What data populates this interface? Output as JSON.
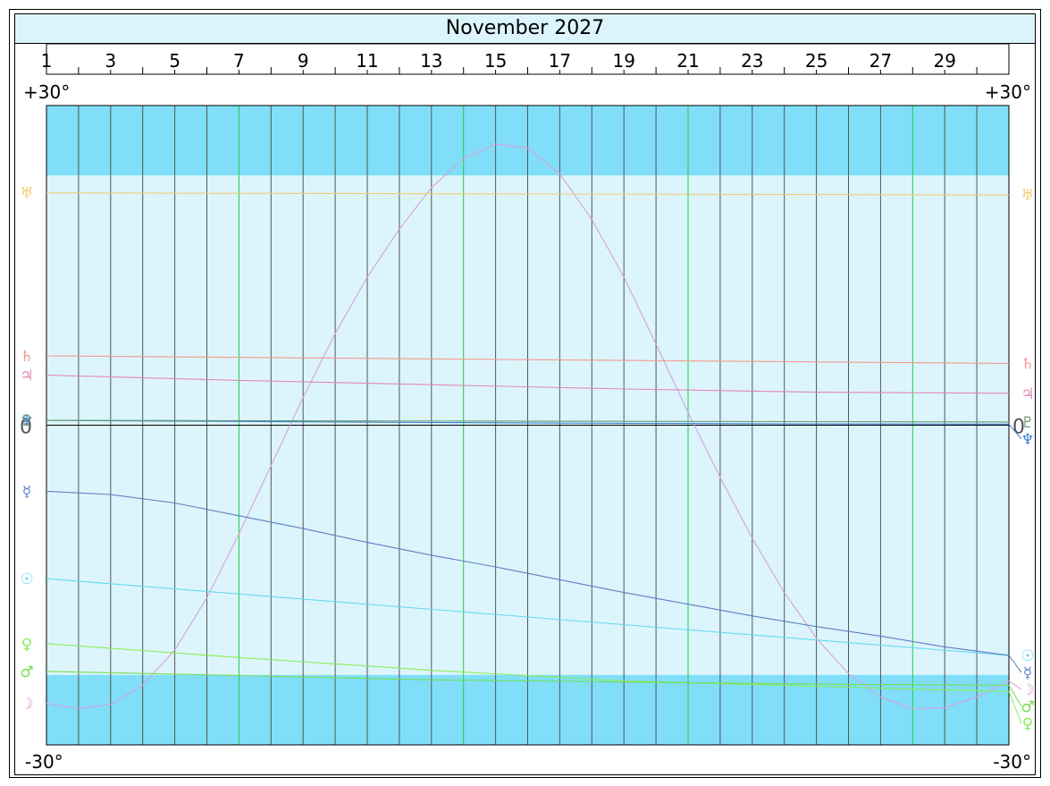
{
  "chart_data": {
    "type": "line",
    "title": "November 2027",
    "x_unit": "day of month",
    "x_range": [
      1,
      31
    ],
    "day_tick_labels": [
      "1",
      "3",
      "5",
      "7",
      "9",
      "11",
      "13",
      "15",
      "17",
      "19",
      "21",
      "23",
      "25",
      "27",
      "29"
    ],
    "ylim": [
      -30,
      30
    ],
    "y_labels": {
      "top_left": "+30°",
      "top_right": "+30°",
      "bottom_left": "-30°",
      "bottom_right": "-30°"
    },
    "highlight_band_limit_deg": 23.44,
    "weekly_gridline_days": [
      7,
      14,
      21,
      28
    ],
    "zero_line_label": "0",
    "series": [
      {
        "name": "Moon",
        "glyph": "☽",
        "color": "#d9a0d9",
        "x": [
          1,
          2,
          3,
          4,
          5,
          6,
          7,
          8,
          9,
          10,
          11,
          12,
          13,
          14,
          15,
          16,
          17,
          18,
          19,
          20,
          21,
          22,
          23,
          24,
          25,
          26,
          27,
          28,
          29,
          30,
          31
        ],
        "y": [
          -26.1,
          -26.6,
          -26.2,
          -24.4,
          -21.1,
          -16.2,
          -10.2,
          -3.8,
          2.6,
          8.6,
          13.9,
          18.4,
          22.3,
          25.0,
          26.4,
          26.0,
          23.6,
          19.3,
          13.9,
          7.6,
          1.2,
          -4.9,
          -10.6,
          -15.7,
          -20.0,
          -23.3,
          -25.5,
          -26.6,
          -26.5,
          -25.5,
          -24.0
        ]
      },
      {
        "name": "Sun",
        "glyph": "☉",
        "color": "#66d9f0",
        "x": [
          1,
          31
        ],
        "y": [
          -14.4,
          -21.6
        ]
      },
      {
        "name": "Mercury",
        "glyph": "☿",
        "color": "#5b7fc4",
        "x": [
          1,
          3,
          5,
          7,
          9,
          11,
          13,
          15,
          17,
          19,
          21,
          23,
          25,
          27,
          29,
          31
        ],
        "y": [
          -6.2,
          -6.5,
          -7.3,
          -8.5,
          -9.7,
          -11.0,
          -12.2,
          -13.3,
          -14.5,
          -15.7,
          -16.8,
          -17.9,
          -18.9,
          -19.8,
          -20.8,
          -21.6
        ]
      },
      {
        "name": "Venus",
        "glyph": "♀",
        "color": "#88ee55",
        "x": [
          1,
          7,
          13,
          19,
          25,
          31
        ],
        "y": [
          -20.5,
          -21.8,
          -23.0,
          -24.0,
          -24.5,
          -25.0
        ]
      },
      {
        "name": "Mars",
        "glyph": "♂",
        "color": "#77dd55",
        "x": [
          1,
          7,
          13,
          19,
          25,
          31
        ],
        "y": [
          -23.1,
          -23.5,
          -23.9,
          -24.1,
          -24.3,
          -24.4
        ]
      },
      {
        "name": "Jupiter",
        "glyph": "♃",
        "color": "#e088b8",
        "x": [
          1,
          7,
          13,
          19,
          25,
          31
        ],
        "y": [
          4.7,
          4.2,
          3.8,
          3.4,
          3.1,
          3.0
        ]
      },
      {
        "name": "Saturn",
        "glyph": "♄",
        "color": "#f29a8c",
        "x": [
          1,
          31
        ],
        "y": [
          6.5,
          5.8
        ]
      },
      {
        "name": "Uranus",
        "glyph": "♅",
        "color": "#f0cc77",
        "x": [
          1,
          31
        ],
        "y": [
          21.8,
          21.6
        ]
      },
      {
        "name": "Neptune",
        "glyph": "♆",
        "color": "#3a80d4",
        "x": [
          1,
          7,
          13,
          19,
          25,
          31
        ],
        "y": [
          0.45,
          0.35,
          0.25,
          0.18,
          0.12,
          0.1
        ]
      },
      {
        "name": "Pluto",
        "glyph": "♇",
        "color": "#6a9a70",
        "x": [
          1,
          31
        ],
        "y": [
          0.45,
          0.3
        ]
      }
    ],
    "grid": true
  },
  "colors": {
    "band_inside": "#dcf5fc",
    "band_outside": "#80def9",
    "day_line": "#555555",
    "week_line": "#22cc44",
    "zero_line": "#000000"
  }
}
